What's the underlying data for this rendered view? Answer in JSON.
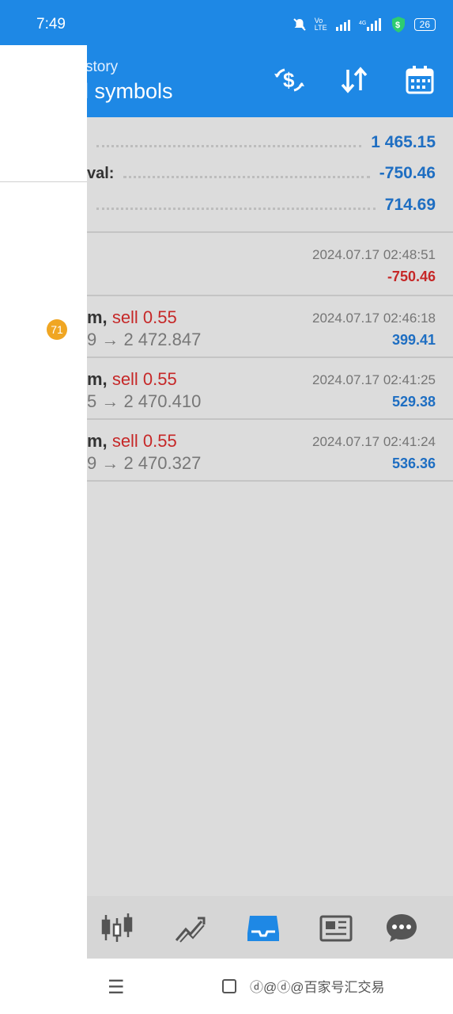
{
  "status": {
    "time": "7:49",
    "battery": "26"
  },
  "header": {
    "subtitle": "story",
    "title": "ll symbols",
    "icons": [
      "dollar-refresh-icon",
      "sort-icon",
      "calendar-icon"
    ]
  },
  "summary": [
    {
      "label": "",
      "value": "1 465.15"
    },
    {
      "label": "val:",
      "value": "-750.46"
    },
    {
      "label": "",
      "value": "714.69"
    }
  ],
  "deals": [
    {
      "line1": "",
      "type": "",
      "line2": "",
      "datetime": "2024.07.17 02:48:51",
      "profit": "-750.46",
      "negative": true
    },
    {
      "line1": "m,",
      "type": "sell 0.55",
      "line2": "9 → 2 472.847",
      "datetime": "2024.07.17 02:46:18",
      "profit": "399.41",
      "negative": false
    },
    {
      "line1": "m,",
      "type": "sell 0.55",
      "line2": "5 → 2 470.410",
      "datetime": "2024.07.17 02:41:25",
      "profit": "529.38",
      "negative": false
    },
    {
      "line1": "m,",
      "type": "sell 0.55",
      "line2": "9 → 2 470.327",
      "datetime": "2024.07.17 02:41:24",
      "profit": "536.36",
      "negative": false
    }
  ],
  "drawer": {
    "badge": "71"
  },
  "tabs": [
    "quotes-icon",
    "chart-icon",
    "history-icon",
    "news-icon",
    "chat-icon"
  ],
  "colors": {
    "accent": "#1e88e5",
    "profit": "#1e6ec2",
    "loss": "#c62828",
    "badge": "#f0a623"
  },
  "navbar": {
    "watermark": "ⓓ@ⓓ@百家号汇交易"
  }
}
